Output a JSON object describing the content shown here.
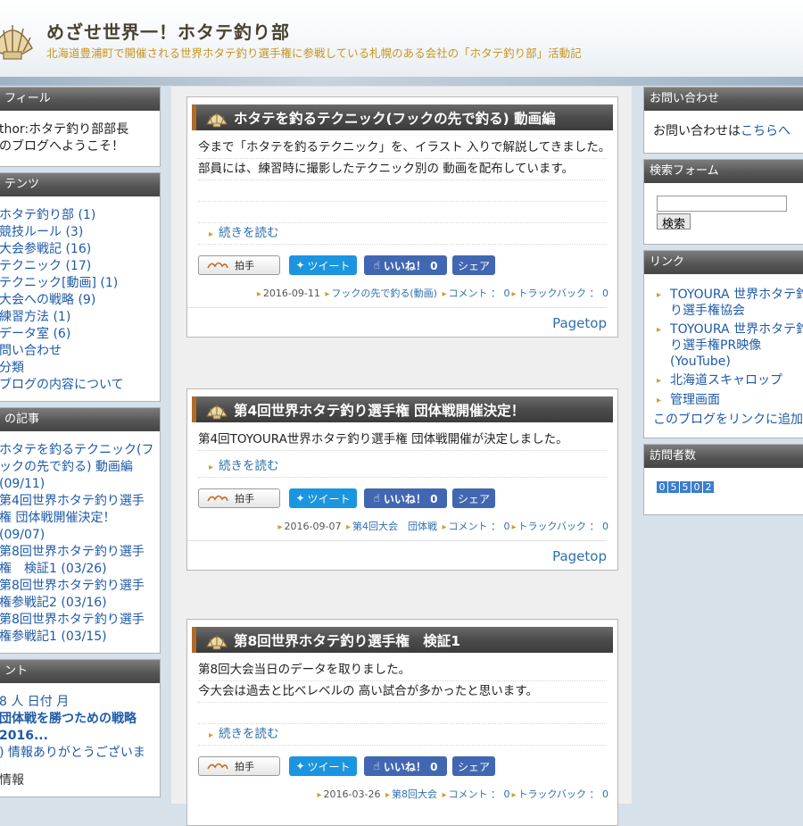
{
  "site": {
    "title": "めざせ世界一！ホタテ釣り部",
    "subtitle": "北海道豊浦町で開催される世界ホタテ釣り選手権に参戦している札幌のある会社の「ホタテ釣り部」活動記"
  },
  "left": {
    "profile": {
      "head": "フィール",
      "lines": [
        "thor:ホタテ釣り部部長",
        "のブログへようこそ！"
      ]
    },
    "categories": {
      "head": "テンツ",
      "items": [
        "ホタテ釣り部 (1)",
        "競技ルール (3)",
        "大会参戦記 (16)",
        "テクニック (17)",
        "テクニック[動画] (1)",
        "大会への戦略 (9)",
        "練習方法 (1)",
        "データ室 (6)",
        "問い合わせ",
        "分類",
        "ブログの内容について"
      ]
    },
    "recent": {
      "head": "の記事",
      "items": [
        "ホタテを釣るテクニック(フックの先で釣る) 動画編 (09/11)",
        "第4回世界ホタテ釣り選手権 団体戦開催決定！ (09/07)",
        "第8回世界ホタテ釣り選手権　検証1 (03/26)",
        "第8回世界ホタテ釣り選手権参戦記2 (03/16)",
        "第8回世界ホタテ釣り選手権参戦記1 (03/15)"
      ]
    },
    "comments": {
      "head": "ント",
      "items": [
        "8 人 日付 月",
        "団体戦を勝つための戦略",
        "2016...",
        ") 情報ありがとうございま"
      ],
      "trailing": "情報"
    }
  },
  "right": {
    "contact": {
      "head": "お問い合わせ",
      "text": "お問い合わせは",
      "link": "こちらへ"
    },
    "search": {
      "head": "検索フォーム",
      "button": "検索",
      "placeholder": ""
    },
    "links": {
      "head": "リンク",
      "items": [
        "TOYOURA 世界ホタテ釣り選手権協会",
        "TOYOURA 世界ホタテ釣り選手権PR映像(YouTube)",
        "北海道スキャロップ",
        "管理画面"
      ],
      "footer": "このブログをリンクに追加する"
    },
    "visitors": {
      "head": "訪問者数",
      "digits": [
        "0",
        "5",
        "5",
        "0",
        "2"
      ]
    }
  },
  "posts": [
    {
      "title": "ホタテを釣るテクニック(フックの先で釣る) 動画編",
      "lines": [
        "今まで「ホタテを釣るテクニック」を、イラスト 入りで解説してきました。",
        "部員には、練習時に撮影したテクニック別の 動画を配布しています。",
        "",
        ""
      ],
      "readmore": "続きを読む",
      "date": "2016-09-11",
      "tag": "フックの先で釣る(動画)",
      "comment": "コメント ： 0",
      "trackback": "トラックバック ： 0"
    },
    {
      "title": "第4回世界ホタテ釣り選手権 団体戦開催決定！",
      "lines": [
        "第4回TOYOURA世界ホタテ釣り選手権 団体戦開催が決定しました。"
      ],
      "readmore": "続きを読む",
      "date": "2016-09-07",
      "tag": "第4回大会　団体戦",
      "comment": "コメント ： 0",
      "trackback": "トラックバック ： 0"
    },
    {
      "title": "第8回世界ホタテ釣り選手権　検証1",
      "lines": [
        "第8回大会当日のデータを取りました。",
        "今大会は過去と比べレベルの 高い試合が多かったと思います。",
        ""
      ],
      "readmore": "続きを読む",
      "date": "2016-03-26",
      "tag": "第8回大会",
      "comment": "コメント ： 0",
      "trackback": "トラックバック ： 0"
    }
  ],
  "buttons": {
    "clap": "拍手",
    "tweet": "ツイート",
    "like": "いいね！ 0",
    "share": "シェア",
    "pagetop": "Pagetop"
  },
  "colors": {
    "accent": "#1e5aa8",
    "header_gradient": "#454545",
    "bullet": "#d79b2a",
    "facebook": "#4267b2",
    "twitter": "#1b95e0"
  }
}
